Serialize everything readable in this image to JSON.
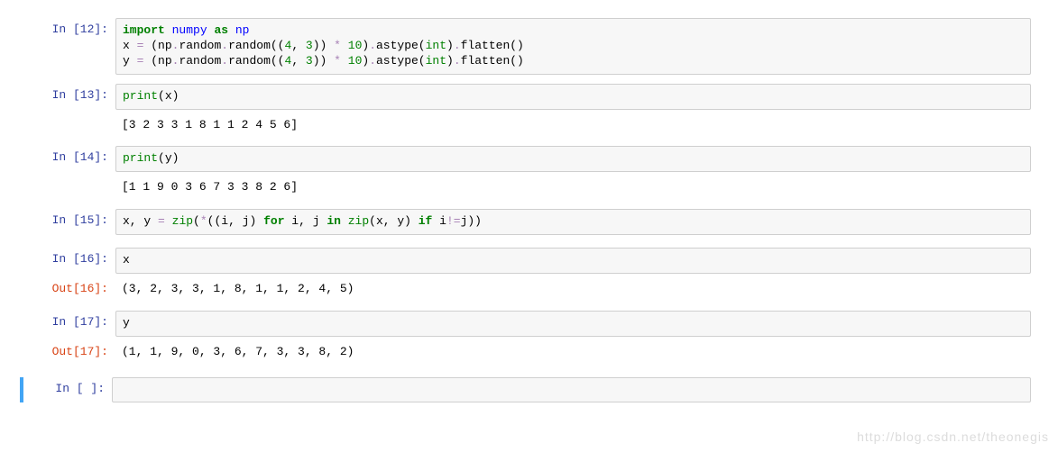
{
  "cells": {
    "c12": {
      "prompt": "In [12]:",
      "lines": [
        {
          "html": "<span class='kw'>import</span> <span class='blue'>numpy</span> <span class='kw'>as</span> <span class='blue'>np</span>"
        },
        {
          "html": "x <span class='op'>=</span> (np<span class='op'>.</span>random<span class='op'>.</span>random((<span class='num'>4</span>, <span class='num'>3</span>)) <span class='op'>*</span> <span class='num'>10</span>)<span class='op'>.</span>astype(<span class='bn'>int</span>)<span class='op'>.</span>flatten()"
        },
        {
          "html": "y <span class='op'>=</span> (np<span class='op'>.</span>random<span class='op'>.</span>random((<span class='num'>4</span>, <span class='num'>3</span>)) <span class='op'>*</span> <span class='num'>10</span>)<span class='op'>.</span>astype(<span class='bn'>int</span>)<span class='op'>.</span>flatten()"
        }
      ]
    },
    "c13": {
      "prompt": "In [13]:",
      "code_html": "<span class='bn'>print</span>(x)",
      "output": "[3 2 3 3 1 8 1 1 2 4 5 6]"
    },
    "c14": {
      "prompt": "In [14]:",
      "code_html": "<span class='bn'>print</span>(y)",
      "output": "[1 1 9 0 3 6 7 3 3 8 2 6]"
    },
    "c15": {
      "prompt": "In [15]:",
      "code_html": "x, y <span class='op'>=</span> <span class='bn'>zip</span>(<span class='op'>*</span>((i, j) <span class='kw'>for</span> i, j <span class='kw'>in</span> <span class='bn'>zip</span>(x, y) <span class='kw'>if</span> i<span class='op'>!=</span>j))"
    },
    "c16": {
      "prompt": "In [16]:",
      "code_html": "x",
      "out_prompt": "Out[16]:",
      "out_val": "(3, 2, 3, 3, 1, 8, 1, 1, 2, 4, 5)"
    },
    "c17": {
      "prompt": "In [17]:",
      "code_html": "y",
      "out_prompt": "Out[17]:",
      "out_val": "(1, 1, 9, 0, 3, 6, 7, 3, 3, 8, 2)"
    },
    "empty": {
      "prompt": "In [ ]:",
      "code_html": ""
    }
  },
  "watermark": "http://blog.csdn.net/theonegis"
}
